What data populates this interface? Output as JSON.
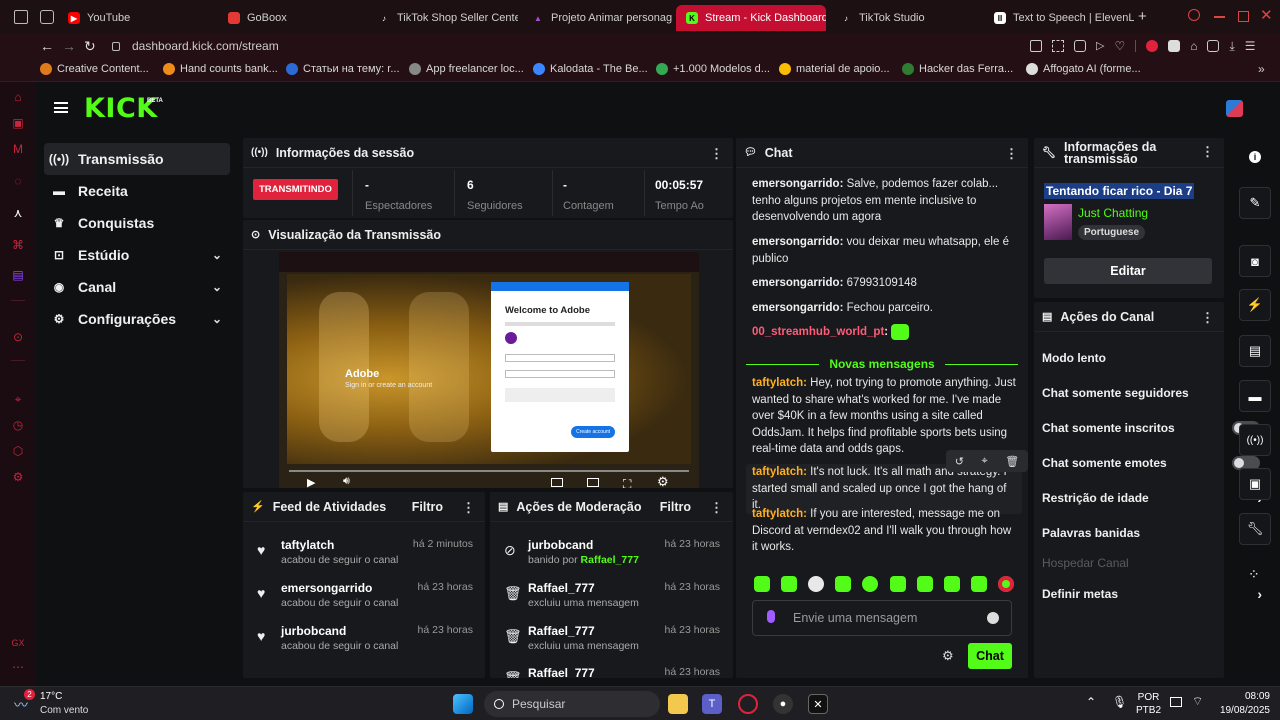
{
  "browser": {
    "tabs": [
      {
        "label": "YouTube",
        "icon": "youtube-icon",
        "color": "#ff0000"
      },
      {
        "label": "GoBoox",
        "icon": "goboox-icon",
        "color": "#e53935"
      },
      {
        "label": "TikTok Shop Seller Cente",
        "icon": "tiktok-icon",
        "color": "#000000"
      },
      {
        "label": "Projeto Animar personage",
        "icon": "project-icon",
        "color": "#b14bd6"
      },
      {
        "label": "Stream - Kick Dashboard",
        "icon": "kick-icon",
        "color": "#53fc18"
      },
      {
        "label": "TikTok Studio",
        "icon": "tiktok-icon",
        "color": "#000000"
      },
      {
        "label": "Text to Speech | ElevenLa",
        "icon": "elevenlabs-icon",
        "color": "#ffffff"
      }
    ],
    "url": "dashboard.kick.com/stream",
    "bookmarks": [
      {
        "label": "Creative Content...",
        "color": "#e07b1c"
      },
      {
        "label": "Hand counts bank...",
        "color": "#f08c1a"
      },
      {
        "label": "Статьи на тему: r...",
        "color": "#2b6bd6"
      },
      {
        "label": "App freelancer loc...",
        "color": "#888888"
      },
      {
        "label": "Kalodata - The Be...",
        "color": "#3a86ff"
      },
      {
        "label": "+1.000 Modelos d...",
        "color": "#34a853"
      },
      {
        "label": "material de apoio...",
        "color": "#fbbc04"
      },
      {
        "label": "Hacker das Ferra...",
        "color": "#2e7d32"
      },
      {
        "label": "Affogato AI (forme...",
        "color": "#dddddd"
      }
    ]
  },
  "kick": {
    "logo": "KICK",
    "logo_badge": "BETA",
    "brand_color": "#53fc18",
    "nav": [
      {
        "label": "Transmissão",
        "icon": "broadcast-icon",
        "active": true,
        "has_chevron": false
      },
      {
        "label": "Receita",
        "icon": "revenue-icon",
        "active": false,
        "has_chevron": false
      },
      {
        "label": "Conquistas",
        "icon": "trophy-icon",
        "active": false,
        "has_chevron": false
      },
      {
        "label": "Estúdio",
        "icon": "studio-icon",
        "active": false,
        "has_chevron": true
      },
      {
        "label": "Canal",
        "icon": "channel-icon",
        "active": false,
        "has_chevron": true
      },
      {
        "label": "Configurações",
        "icon": "settings-icon",
        "active": false,
        "has_chevron": true
      }
    ]
  },
  "session": {
    "title": "Informações da sessão",
    "status": "TRANSMITINDO",
    "stats": [
      {
        "value": "-",
        "label": "Espectadores"
      },
      {
        "value": "6",
        "label": "Seguidores"
      },
      {
        "value": "-",
        "label": "Contagem"
      },
      {
        "value": "00:05:57",
        "label": "Tempo Ao"
      }
    ]
  },
  "preview": {
    "title": "Visualização da Transmissão",
    "adobe_title": "Welcome to Adobe",
    "adobe_logo": "Adobe",
    "adobe_sub": "Sign in or create an account",
    "adobe_button": "Create account"
  },
  "feed": {
    "title": "Feed de Atividades",
    "filter": "Filtro",
    "items": [
      {
        "name": "taftylatch",
        "action": "acabou de seguir o canal",
        "time": "há 2 minutos"
      },
      {
        "name": "emersongarrido",
        "action": "acabou de seguir o canal",
        "time": "há 23 horas"
      },
      {
        "name": "jurbobcand",
        "action": "acabou de seguir o canal",
        "time": "há 23 horas"
      }
    ]
  },
  "moderation": {
    "title": "Ações de Moderação",
    "filter": "Filtro",
    "items": [
      {
        "name": "jurbobcand",
        "action": "banido por",
        "actor": "Raffael_777",
        "time": "há 23 horas",
        "icon": "ban-icon"
      },
      {
        "name": "Raffael_777",
        "action": "excluiu uma mensagem",
        "actor": "",
        "time": "há 23 horas",
        "icon": "trash-icon"
      },
      {
        "name": "Raffael_777",
        "action": "excluiu uma mensagem",
        "actor": "",
        "time": "há 23 horas",
        "icon": "trash-icon"
      },
      {
        "name": "Raffael_777",
        "action": "",
        "actor": "",
        "time": "há 23 horas",
        "icon": "trash-icon"
      }
    ]
  },
  "chat": {
    "title": "Chat",
    "messages": [
      {
        "user": "emersongarrido",
        "text": "Salve, podemos fazer colab... tenho alguns projetos em mente inclusive to desenvolvendo um agora",
        "color": "#e8e8e8"
      },
      {
        "user": "emersongarrido",
        "text": "vou deixar meu whatsapp, ele é publico",
        "color": "#e8e8e8"
      },
      {
        "user": "emersongarrido",
        "text": "67993109148",
        "color": "#e8e8e8"
      },
      {
        "user": "emersongarrido",
        "text": "Fechou parceiro.",
        "color": "#e8e8e8"
      },
      {
        "user": "00_streamhub_world_pt",
        "text": "",
        "color": "#ff5c7a"
      }
    ],
    "new_messages": "Novas mensagens",
    "new_messages_2": [
      {
        "user": "taftylatch",
        "text": "Hey, not trying to promote anything. Just wanted to share what's worked for me. I've made over $40K in a few months using a site called OddsJam. It helps find profitable sports bets using real-time data and odds gaps.",
        "color": "#ffb020"
      },
      {
        "user": "taftylatch",
        "text": "It's not luck. It's all math and strategy. I started small and scaled up once I got the hang of it.",
        "color": "#ffb020"
      },
      {
        "user": "taftylatch",
        "text": "If you are interested, message me on Discord at verndex02 and I'll walk you through how it works.",
        "color": "#ffb020"
      }
    ],
    "input_placeholder": "Envie uma mensagem",
    "send_label": "Chat"
  },
  "stream_info": {
    "title": "Informações da transmissão",
    "stream_title": "Tentando ficar rico - Dia 7",
    "category": "Just Chatting",
    "language": "Portuguese",
    "edit_label": "Editar"
  },
  "channel_actions": {
    "title": "Ações do Canal",
    "items": [
      {
        "label": "Modo lento",
        "control": "chevron",
        "disabled": false
      },
      {
        "label": "Chat somente seguidores",
        "control": "chevron",
        "disabled": false
      },
      {
        "label": "Chat somente inscritos",
        "control": "toggle",
        "disabled": false
      },
      {
        "label": "Chat somente emotes",
        "control": "toggle",
        "disabled": false
      },
      {
        "label": "Restrição de idade",
        "control": "chevron",
        "disabled": false
      },
      {
        "label": "Palavras banidas",
        "control": "chevron",
        "disabled": false
      },
      {
        "label": "Hospedar Canal",
        "control": "none",
        "disabled": true
      },
      {
        "label": "Definir metas",
        "control": "chevron",
        "disabled": false
      }
    ]
  },
  "taskbar": {
    "weather_temp": "17°C",
    "weather_desc": "Com vento",
    "weather_badge": "2",
    "search_placeholder": "Pesquisar",
    "lang": "POR",
    "lang_sub": "PTB2",
    "time": "08:09",
    "date": "19/08/2025"
  }
}
